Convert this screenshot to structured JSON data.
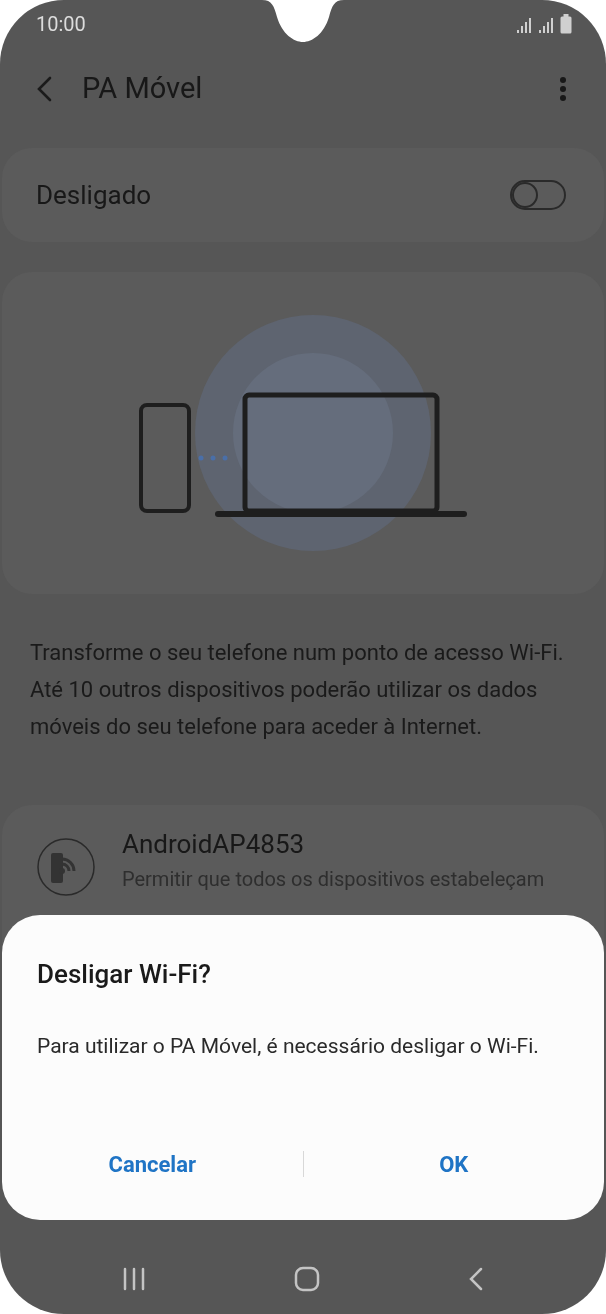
{
  "status_bar": {
    "time": "10:00"
  },
  "app_bar": {
    "title": "PA Móvel"
  },
  "switch": {
    "label": "Desligado",
    "on": false
  },
  "description": "Transforme o seu telefone num ponto de acesso Wi-Fi. Até 10 outros dispositivos poderão utilizar os dados móveis do seu telefone para aceder à Internet.",
  "network": {
    "name": "AndroidAP4853",
    "subtitle": "Permitir que todos os dispositivos estabeleçam"
  },
  "dialog": {
    "title": "Desligar Wi-Fi?",
    "message": "Para utilizar o PA Móvel, é necessário desligar o Wi-Fi.",
    "buttons": [
      "Cancelar",
      "OK"
    ]
  }
}
